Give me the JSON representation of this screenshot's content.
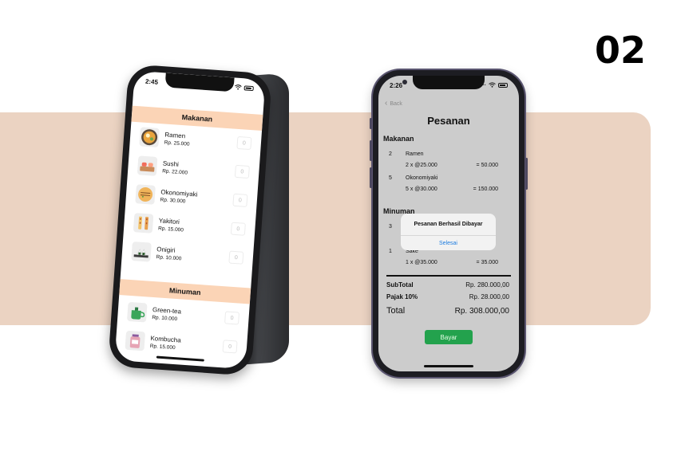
{
  "step_number": "02",
  "left_phone": {
    "status_time": "2:45",
    "sections": [
      {
        "title": "Makanan",
        "items": [
          {
            "name": "Ramen",
            "price": "Rp. 25.000",
            "qty": "0",
            "icon": "ramen-bowl-icon"
          },
          {
            "name": "Sushi",
            "price": "Rp. 22.000",
            "qty": "0",
            "icon": "sushi-icon"
          },
          {
            "name": "Okonomiyaki",
            "price": "Rp. 30.000",
            "qty": "0",
            "icon": "okonomiyaki-icon"
          },
          {
            "name": "Yakitori",
            "price": "Rp. 15.000",
            "qty": "0",
            "icon": "yakitori-icon"
          },
          {
            "name": "Onigiri",
            "price": "Rp. 10.000",
            "qty": "0",
            "icon": "onigiri-icon"
          }
        ]
      },
      {
        "title": "Minuman",
        "items": [
          {
            "name": "Green-tea",
            "price": "Rp. 10.000",
            "qty": "0",
            "icon": "green-tea-icon"
          },
          {
            "name": "Kombucha",
            "price": "Rp. 15.000",
            "qty": "0",
            "icon": "kombucha-icon"
          }
        ]
      }
    ]
  },
  "right_phone": {
    "status_time": "2:26",
    "back_label": "Back",
    "title": "Pesanan",
    "food_label": "Makanan",
    "drink_label": "Minuman",
    "food_rows": [
      {
        "qty": "2",
        "name": "Ramen",
        "line": "2 x @25.000",
        "total": "= 50.000"
      },
      {
        "qty": "5",
        "name": "Okonomiyaki",
        "line": "5 x @30.000",
        "total": "= 150.000"
      }
    ],
    "drink_rows": [
      {
        "qty": "3",
        "name": "",
        "line": "",
        "total": ""
      },
      {
        "qty": "1",
        "name": "Sake",
        "line": "1 x @35.000",
        "total": "= 35.000"
      }
    ],
    "subtotal_label": "SubTotal",
    "subtotal_value": "Rp. 280.000,00",
    "tax_label": "Pajak 10%",
    "tax_value": "Rp. 28.000,00",
    "total_label": "Total",
    "total_value": "Rp. 308.000,00",
    "pay_label": "Bayar",
    "alert": {
      "title": "Pesanan Berhasil Dibayar",
      "button": "Selesai"
    }
  },
  "colors": {
    "band": "#ebd3c2",
    "section_header": "#fbd4b6",
    "pay_button": "#23a24d",
    "alert_button": "#1f7de0"
  }
}
